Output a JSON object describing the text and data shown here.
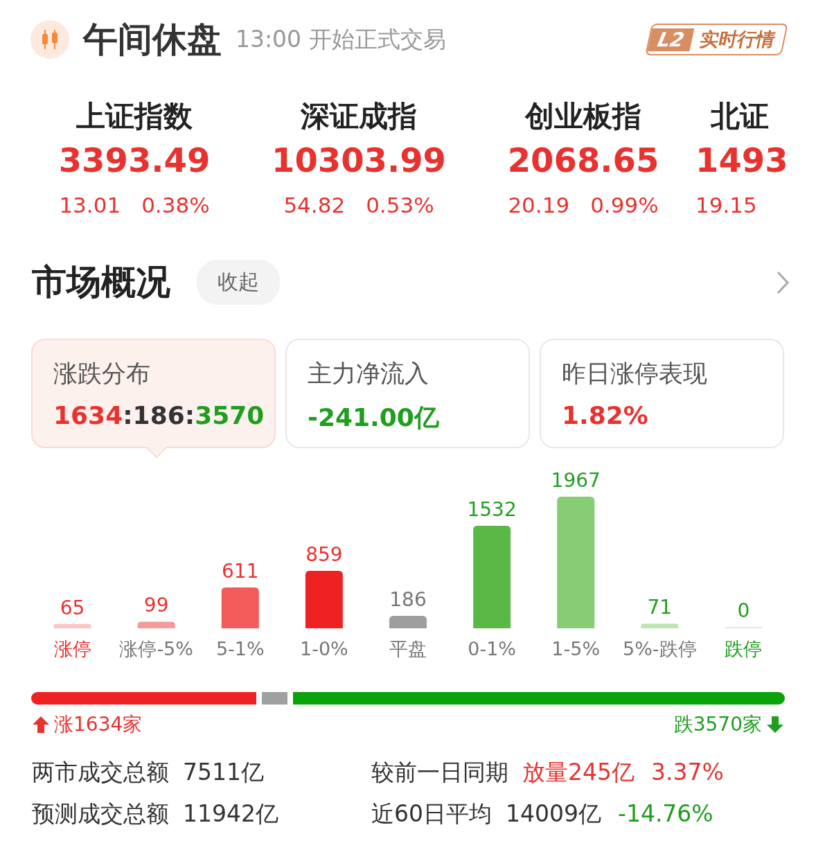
{
  "header": {
    "title": "午间休盘",
    "subtitle": "13:00 开始正式交易",
    "badge": {
      "level_tag": "L2",
      "label": "实时行情"
    }
  },
  "indices": [
    {
      "name": "上证指数",
      "value": "3393.49",
      "change": "13.01",
      "percent": "0.38%"
    },
    {
      "name": "深证成指",
      "value": "10303.99",
      "change": "54.82",
      "percent": "0.53%"
    },
    {
      "name": "创业板指",
      "value": "2068.65",
      "change": "20.19",
      "percent": "0.99%"
    },
    {
      "name": "北证",
      "value": "1493",
      "change": "19.15"
    }
  ],
  "market": {
    "title": "市场概况",
    "collapse_button": "收起",
    "cards": [
      {
        "label": "涨跌分布",
        "selected": true,
        "value_parts": [
          {
            "text": "1634",
            "color": "#e8322f"
          },
          {
            "text": ":",
            "color": "#333333"
          },
          {
            "text": "186",
            "color": "#333333"
          },
          {
            "text": ":",
            "color": "#333333"
          },
          {
            "text": "3570",
            "color": "#1f9e1f"
          }
        ]
      },
      {
        "label": "主力净流入",
        "selected": false,
        "value_parts": [
          {
            "text": "-241.00亿",
            "color": "#1f9e1f"
          }
        ]
      },
      {
        "label": "昨日涨停表现",
        "selected": false,
        "value_parts": [
          {
            "text": "1.82%",
            "color": "#e8322f"
          }
        ]
      }
    ],
    "chart_data": {
      "type": "bar",
      "categories": [
        "涨停",
        "涨停-5%",
        "5-1%",
        "1-0%",
        "平盘",
        "0-1%",
        "1-5%",
        "5%-跌停",
        "跌停"
      ],
      "values": [
        65,
        99,
        611,
        859,
        186,
        1532,
        1967,
        71,
        0
      ],
      "colors": [
        "#f9c6c6",
        "#f49a9a",
        "#f45b5b",
        "#ee2222",
        "#9e9e9e",
        "#5ab946",
        "#86cd73",
        "#bfe5b3",
        "#dcefd6"
      ],
      "data_labels": true
    },
    "breadth": {
      "up_label": "涨1634家",
      "down_label": "跌3570家"
    },
    "stats": [
      {
        "label": "两市成交总额",
        "parts": [
          {
            "text": "7511亿",
            "color": "#333333"
          }
        ]
      },
      {
        "label": "较前一日同期",
        "parts": [
          {
            "text": "放量245亿",
            "color": "#e8322f"
          },
          {
            "text": "3.37%",
            "color": "#e8322f"
          }
        ]
      },
      {
        "label": "预测成交总额",
        "parts": [
          {
            "text": "11942亿",
            "color": "#333333"
          }
        ]
      },
      {
        "label": "近60日平均",
        "parts": [
          {
            "text": "14009亿",
            "color": "#333333"
          },
          {
            "text": "-14.76%",
            "color": "#1f9e1f"
          }
        ]
      }
    ]
  }
}
